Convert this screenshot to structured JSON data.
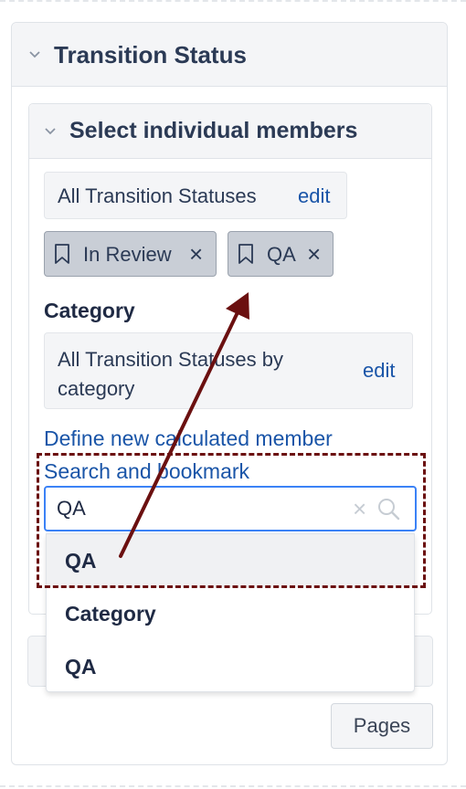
{
  "panel": {
    "title": "Transition Status",
    "section": {
      "title": "Select individual members",
      "all_chip": {
        "label": "All Transition Statuses",
        "edit": "edit"
      },
      "selected_tags": [
        {
          "label": "In Review",
          "remove": "×"
        },
        {
          "label": "QA",
          "remove": "×"
        }
      ],
      "category": {
        "heading": "Category",
        "chip_label": "All Transition Statuses by category",
        "edit": "edit"
      },
      "define_link": "Define new calculated member",
      "search_link": "Search and bookmark",
      "search": {
        "value": "QA",
        "clear": "×"
      },
      "dropdown": [
        {
          "label": "QA",
          "highlighted": true
        },
        {
          "label": "Category",
          "highlighted": false
        },
        {
          "label": "QA",
          "highlighted": false
        }
      ]
    },
    "pages_button": "Pages"
  },
  "colors": {
    "accent_link": "#1a55a8",
    "focus_border": "#3b82f6",
    "annotation": "#6b1010",
    "tag_bg": "#c9ced6"
  },
  "icons": [
    "chevron-down-icon",
    "bookmark-icon",
    "close-icon",
    "search-icon",
    "clear-icon"
  ]
}
